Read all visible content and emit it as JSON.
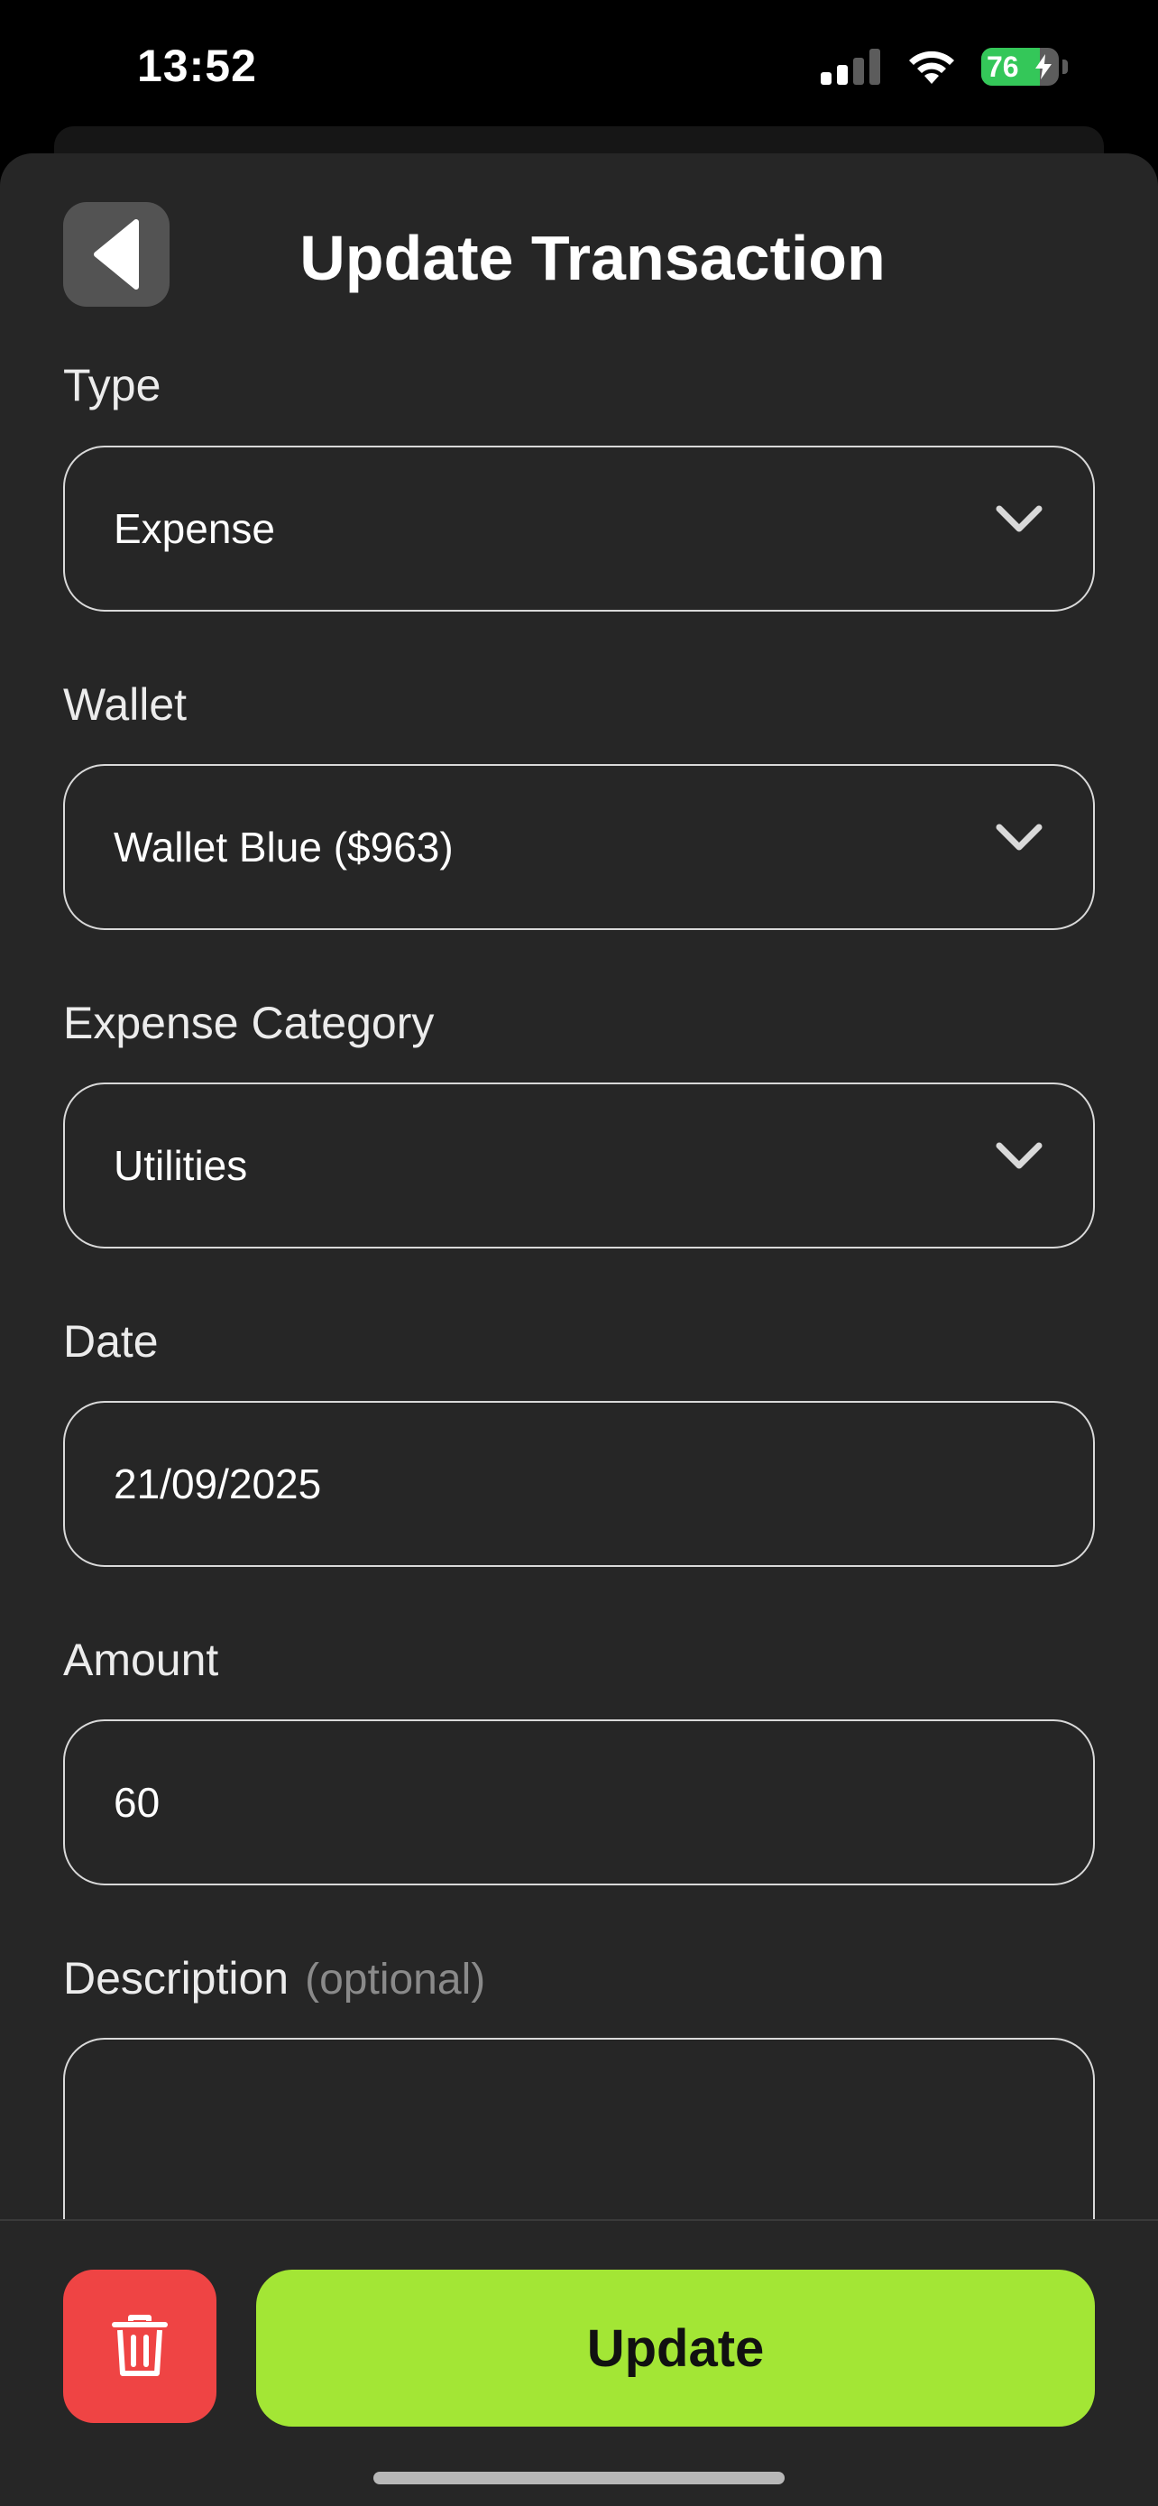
{
  "status_bar": {
    "time": "13:52",
    "battery_percent": 76,
    "battery_text": "76",
    "icons": [
      "cellular-signal-icon",
      "wifi-icon",
      "battery-charging-icon"
    ],
    "battery_color": "#34c759"
  },
  "header": {
    "title": "Update Transaction",
    "back_icon": "back-arrow-icon"
  },
  "form": {
    "type": {
      "label": "Type",
      "value": "Expense"
    },
    "wallet": {
      "label": "Wallet",
      "value": "Wallet Blue ($963)"
    },
    "category": {
      "label": "Expense Category",
      "value": "Utilities"
    },
    "date": {
      "label": "Date",
      "value": "21/09/2025"
    },
    "amount": {
      "label": "Amount",
      "value": "60"
    },
    "description": {
      "label": "Description",
      "optional": "(optional)",
      "value": ""
    }
  },
  "footer": {
    "delete_icon": "trash-icon",
    "update_label": "Update",
    "delete_color": "#ef4444",
    "update_color": "#a3e635"
  }
}
